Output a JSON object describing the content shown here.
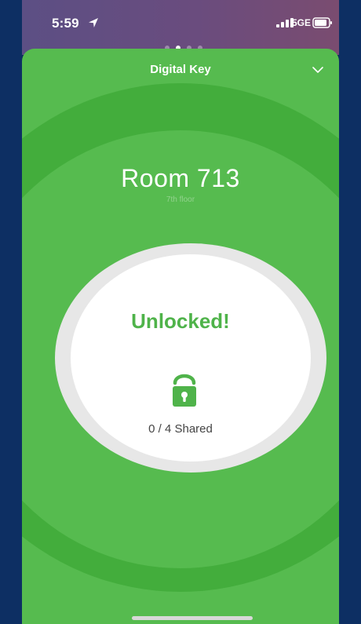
{
  "status_bar": {
    "time": "5:59",
    "network": "5GE"
  },
  "header": {
    "title": "Digital Key"
  },
  "room": {
    "title": "Room 713",
    "subtitle": "7th floor"
  },
  "key_status": {
    "text": "Unlocked!",
    "shared": "0 / 4 Shared"
  },
  "colors": {
    "green": "#56bb4f",
    "dark_green": "#43ad3c",
    "accent": "#4fb34a",
    "ring": "#e7e7e7"
  },
  "icons": {
    "location": "location-arrow-icon",
    "signal": "signal-icon",
    "battery": "battery-icon",
    "chevron": "chevron-down-icon",
    "lock": "unlocked-lock-icon"
  }
}
